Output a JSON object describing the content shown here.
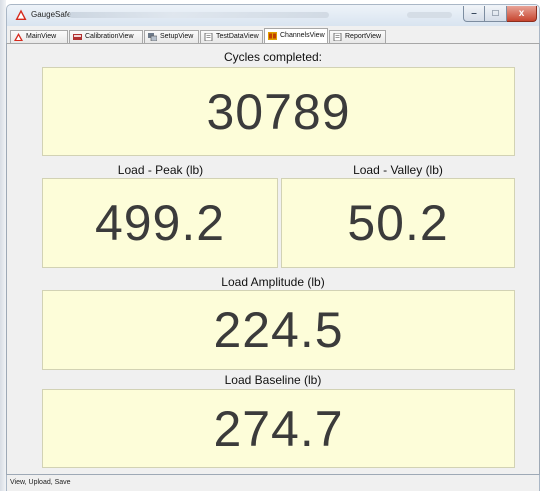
{
  "window": {
    "title": "GaugeSafe",
    "controls": {
      "minimize": "–",
      "maximize": "□",
      "close": "x"
    }
  },
  "tabs": [
    {
      "label": "MainView",
      "icon": "warning-triangle-icon",
      "icon_color": "#d62b1e"
    },
    {
      "label": "CalibrationView",
      "icon": "calibration-icon",
      "icon_color": "#b03030"
    },
    {
      "label": "SetupView",
      "icon": "setup-icon",
      "icon_color": "#555555"
    },
    {
      "label": "TestDataView",
      "icon": "document-icon",
      "icon_color": "#555555"
    },
    {
      "label": "ChannelsView",
      "icon": "channels-icon",
      "icon_color": "#e0a000",
      "active": true
    },
    {
      "label": "ReportView",
      "icon": "report-icon",
      "icon_color": "#555555"
    }
  ],
  "channels": {
    "cycles": {
      "label": "Cycles completed:",
      "value": "30789"
    },
    "peak": {
      "label": "Load - Peak (lb)",
      "value": "499.2"
    },
    "valley": {
      "label": "Load - Valley (lb)",
      "value": "50.2"
    },
    "amplitude": {
      "label": "Load Amplitude (lb)",
      "value": "224.5"
    },
    "baseline": {
      "label": "Load Baseline (lb)",
      "value": "274.7"
    }
  },
  "status": {
    "text": "View, Upload, Save"
  },
  "colors": {
    "panel_background": "#fdfdd9",
    "value_text": "#3b3b3b",
    "window_background": "#f0f0f0"
  }
}
